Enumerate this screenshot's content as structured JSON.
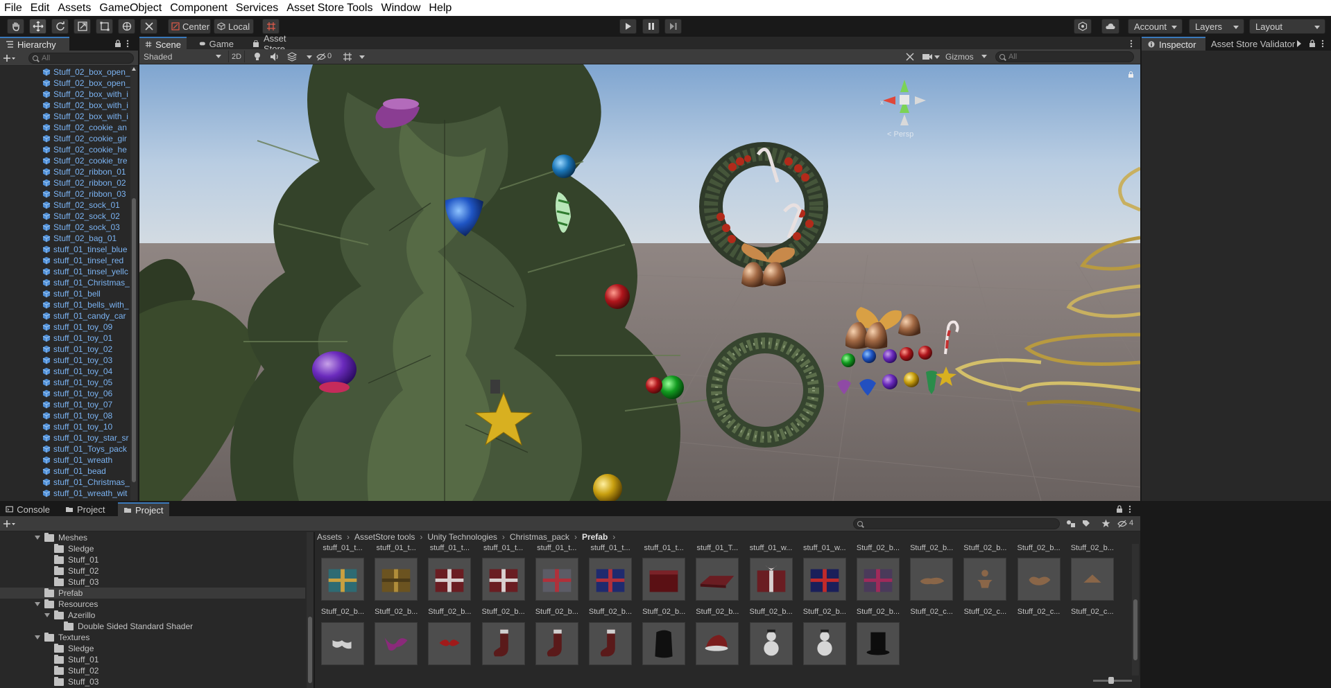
{
  "menu": [
    "File",
    "Edit",
    "Assets",
    "GameObject",
    "Component",
    "Services",
    "Asset Store Tools",
    "Window",
    "Help"
  ],
  "toolbar": {
    "pivot_label": "Center",
    "space_label": "Local",
    "account_label": "Account",
    "layers_label": "Layers",
    "layout_label": "Layout"
  },
  "hierarchy": {
    "tab_label": "Hierarchy",
    "search_placeholder": "All",
    "items": [
      "Stuff_02_box_open_",
      "Stuff_02_box_open_",
      "Stuff_02_box_with_i",
      "Stuff_02_box_with_i",
      "Stuff_02_box_with_i",
      "Stuff_02_cookie_an",
      "Stuff_02_cookie_gir",
      "Stuff_02_cookie_he",
      "Stuff_02_cookie_tre",
      "Stuff_02_ribbon_01",
      "Stuff_02_ribbon_02",
      "Stuff_02_ribbon_03",
      "Stuff_02_sock_01",
      "Stuff_02_sock_02",
      "Stuff_02_sock_03",
      "Stuff_02_bag_01",
      "stuff_01_tinsel_blue",
      "stuff_01_tinsel_red",
      "stuff_01_tinsel_yellc",
      "stuff_01_Christmas_",
      "stuff_01_bell",
      "stuff_01_bells_with_",
      "stuff_01_candy_car",
      "stuff_01_toy_09",
      "stuff_01_toy_01",
      "stuff_01_toy_02",
      "stuff_01_toy_03",
      "stuff_01_toy_04",
      "stuff_01_toy_05",
      "stuff_01_toy_06",
      "stuff_01_toy_07",
      "stuff_01_toy_08",
      "stuff_01_toy_10",
      "stuff_01_toy_star_sr",
      "stuff_01_Toys_pack",
      "stuff_01_wreath",
      "stuff_01_bead",
      "stuff_01_Christmas_",
      "stuff_01_wreath_wit"
    ]
  },
  "scene_tabs": [
    "Scene",
    "Game",
    "Asset Store"
  ],
  "scene_toolbar": {
    "shading_mode": "Shaded",
    "mode_2d": "2D",
    "hidden_count": "0",
    "gizmos_label": "Gizmos",
    "search_placeholder": "All",
    "persp_label": "< Persp",
    "gizmo_x": "x"
  },
  "inspector_tabs": [
    "Inspector",
    "Asset Store Validator"
  ],
  "bottom_tabs": [
    "Console",
    "Project",
    "Project"
  ],
  "project": {
    "hidden_count": "4",
    "tree": [
      {
        "label": "Meshes",
        "depth": 1,
        "expanded": true
      },
      {
        "label": "Sledge",
        "depth": 2,
        "expanded": false
      },
      {
        "label": "Stuff_01",
        "depth": 2,
        "expanded": false
      },
      {
        "label": "Stuff_02",
        "depth": 2,
        "expanded": false
      },
      {
        "label": "Stuff_03",
        "depth": 2,
        "expanded": false
      },
      {
        "label": "Prefab",
        "depth": 1,
        "expanded": false,
        "selected": true
      },
      {
        "label": "Resources",
        "depth": 1,
        "expanded": true
      },
      {
        "label": "Azerillo",
        "depth": 2,
        "expanded": true
      },
      {
        "label": "Double Sided Standard Shader",
        "depth": 3,
        "expanded": false
      },
      {
        "label": "Textures",
        "depth": 1,
        "expanded": true
      },
      {
        "label": "Sledge",
        "depth": 2,
        "expanded": false
      },
      {
        "label": "Stuff_01",
        "depth": 2,
        "expanded": false
      },
      {
        "label": "Stuff_02",
        "depth": 2,
        "expanded": false
      },
      {
        "label": "Stuff_03",
        "depth": 2,
        "expanded": false
      }
    ],
    "breadcrumb": [
      "Assets",
      "AssetStore tools",
      "Unity Technologies",
      "Christmas_pack",
      "Prefab"
    ],
    "top_captions": [
      "stuff_01_t...",
      "stuff_01_t...",
      "stuff_01_t...",
      "stuff_01_t...",
      "stuff_01_t...",
      "stuff_01_t...",
      "stuff_01_t...",
      "stuff_01_T...",
      "stuff_01_w...",
      "stuff_01_w...",
      "Stuff_02_b...",
      "Stuff_02_b...",
      "Stuff_02_b...",
      "Stuff_02_b...",
      "Stuff_02_b..."
    ],
    "row1": [
      {
        "caption": "Stuff_02_b...",
        "kind": "box-teal"
      },
      {
        "caption": "Stuff_02_b...",
        "kind": "box-gold"
      },
      {
        "caption": "Stuff_02_b...",
        "kind": "box-red"
      },
      {
        "caption": "Stuff_02_b...",
        "kind": "box-red"
      },
      {
        "caption": "Stuff_02_b...",
        "kind": "box-grey"
      },
      {
        "caption": "Stuff_02_b...",
        "kind": "box-blue"
      },
      {
        "caption": "Stuff_02_b...",
        "kind": "box-open-red"
      },
      {
        "caption": "Stuff_02_b...",
        "kind": "lid-red"
      },
      {
        "caption": "Stuff_02_b...",
        "kind": "box-red-ribbon"
      },
      {
        "caption": "Stuff_02_b...",
        "kind": "box-navy"
      },
      {
        "caption": "Stuff_02_b...",
        "kind": "box-purple"
      },
      {
        "caption": "Stuff_02_c...",
        "kind": "cookie-flat"
      },
      {
        "caption": "Stuff_02_c...",
        "kind": "cookie-man"
      },
      {
        "caption": "Stuff_02_c...",
        "kind": "cookie-heart"
      },
      {
        "caption": "Stuff_02_c...",
        "kind": "cookie-tree"
      }
    ],
    "row2": [
      {
        "kind": "ribbon-white"
      },
      {
        "kind": "ribbon-purple"
      },
      {
        "kind": "ribbon-red"
      },
      {
        "kind": "sock-red"
      },
      {
        "kind": "sock-red"
      },
      {
        "kind": "sock-red"
      },
      {
        "kind": "bag-black"
      },
      {
        "kind": "hat-red"
      },
      {
        "kind": "snowman"
      },
      {
        "kind": "snowman"
      },
      {
        "kind": "tophat"
      }
    ]
  },
  "colors": {
    "accent_blue": "#3a79bb",
    "hierarchy_text": "#7bb3f2",
    "panel_bg": "#282828",
    "sky": "#8fb2d8",
    "ground": "#6e6664"
  }
}
